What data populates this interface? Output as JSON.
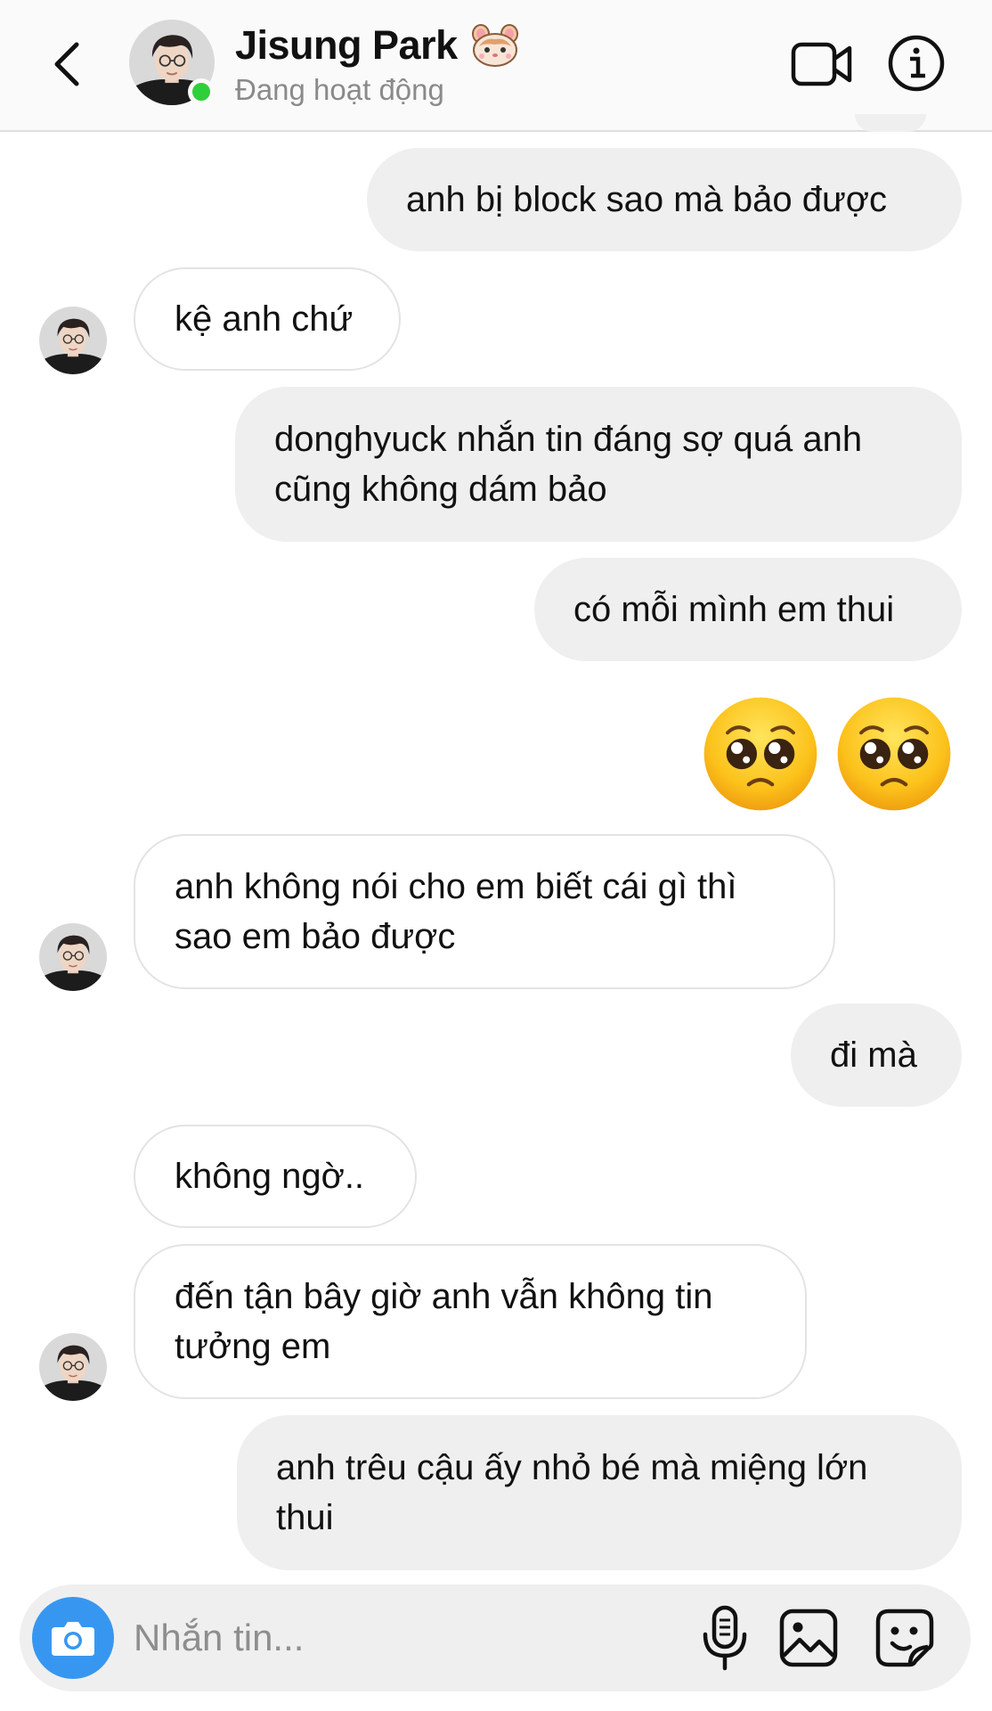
{
  "header": {
    "contact_name": "Jisung Park",
    "name_emoji": "hamster-emoji",
    "status": "Đang hoạt động",
    "icons": [
      "back-arrow-icon",
      "video-camera-icon",
      "info-icon"
    ],
    "online_color": "#2fcf3a"
  },
  "messages": [
    {
      "side": "out",
      "lines": [
        "anh bị block sao mà bảo được"
      ]
    },
    {
      "side": "in",
      "lines": [
        "kệ anh chứ"
      ]
    },
    {
      "side": "out",
      "lines": [
        "donghyuck nhắn tin đáng sợ quá anh",
        "cũng không dám bảo"
      ]
    },
    {
      "side": "out",
      "lines": [
        "có mỗi mình em thui"
      ]
    },
    {
      "side": "out",
      "emoji": [
        "pleading-face-emoji",
        "pleading-face-emoji"
      ]
    },
    {
      "side": "in",
      "lines": [
        "anh không nói cho em biết cái gì thì",
        "sao em bảo được"
      ]
    },
    {
      "side": "out",
      "lines": [
        "đi mà"
      ]
    },
    {
      "side": "in",
      "lines": [
        "không ngờ.."
      ]
    },
    {
      "side": "in",
      "lines": [
        "đến tận bây giờ anh vẫn không tin",
        "tưởng em"
      ]
    },
    {
      "side": "out",
      "lines": [
        "anh trêu cậu ấy nhỏ bé mà miệng lớn",
        "thui"
      ]
    }
  ],
  "composer": {
    "placeholder": "Nhắn tin...",
    "icons": [
      "camera-icon",
      "microphone-icon",
      "gallery-icon",
      "sticker-icon"
    ],
    "camera_color": "#3797f0"
  },
  "colors": {
    "outgoing_bubble": "#efefef",
    "incoming_border": "#e3e3e3",
    "header_bg": "#fafafa"
  }
}
